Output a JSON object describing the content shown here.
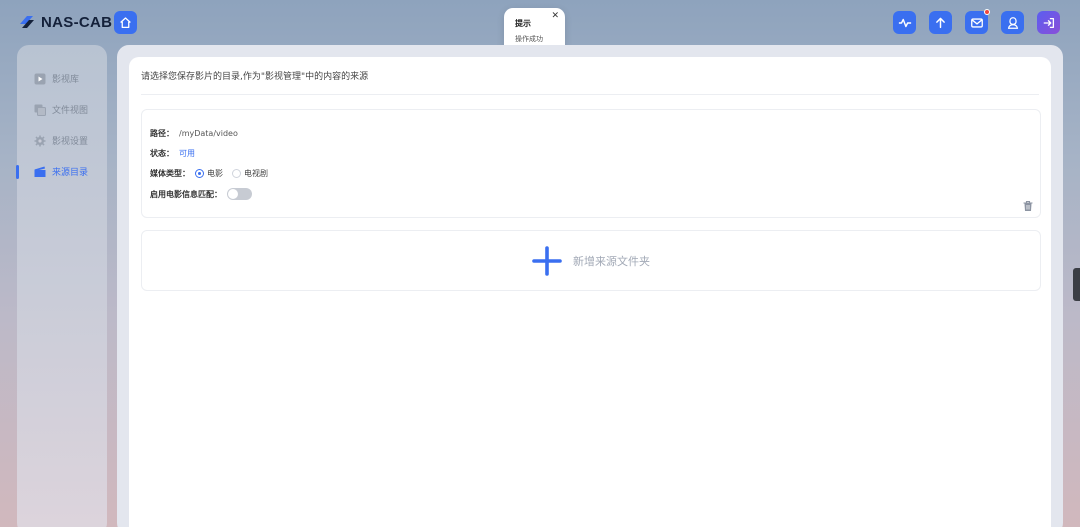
{
  "app": {
    "logo_text": "NAS-CAB"
  },
  "topbar": {
    "icons": [
      "activity-icon",
      "upload-icon",
      "mail-icon",
      "user-icon",
      "logout-icon"
    ],
    "accent": "#3a6ff0"
  },
  "toast": {
    "title": "提示",
    "message": "操作成功",
    "close": "✕"
  },
  "sidebar": {
    "items": [
      {
        "label": "影视库",
        "icon": "play-icon",
        "active": false
      },
      {
        "label": "文件视图",
        "icon": "copy-icon",
        "active": false
      },
      {
        "label": "影视设置",
        "icon": "gear-icon",
        "active": false
      },
      {
        "label": "来源目录",
        "icon": "clapperboard-icon",
        "active": true
      }
    ]
  },
  "main": {
    "description": "请选择您保存影片的目录,作为\"影视管理\"中的内容的来源",
    "source": {
      "path_label": "路径：",
      "path_value": "/myData/video",
      "status_label": "状态：",
      "status_value": "可用",
      "media_type_label": "媒体类型：",
      "media_options": [
        "电影",
        "电视剧"
      ],
      "media_selected": "电影",
      "match_label": "启用电影信息匹配：",
      "match_enabled": false
    },
    "add_button_label": "新增来源文件夹"
  }
}
